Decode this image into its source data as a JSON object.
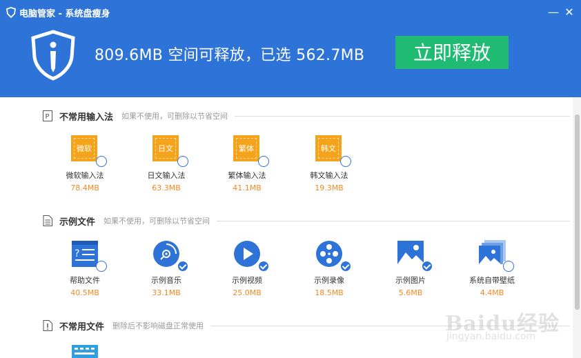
{
  "window": {
    "title": "电脑管家 - 系统盘瘦身",
    "minimize": "—",
    "close": "✕"
  },
  "header": {
    "headline": "809.6MB 空间可释放，已选 562.7MB",
    "release_button": "立即释放"
  },
  "sections": [
    {
      "title": "不常用输入法",
      "desc": "如果不使用，可删除以节省空间",
      "icon": "ime-p-icon",
      "items": [
        {
          "tile": "微软",
          "label": "微软输入法",
          "size": "78.4MB",
          "checked": false,
          "icon": "microsoft-ime-icon"
        },
        {
          "tile": "日文",
          "label": "日文输入法",
          "size": "63.3MB",
          "checked": false,
          "icon": "japanese-ime-icon"
        },
        {
          "tile": "繁体",
          "label": "繁体输入法",
          "size": "41.1MB",
          "checked": false,
          "icon": "traditional-chinese-ime-icon"
        },
        {
          "tile": "韩文",
          "label": "韩文输入法",
          "size": "19.3MB",
          "checked": false,
          "icon": "korean-ime-icon"
        }
      ]
    },
    {
      "title": "示例文件",
      "desc": "如果不使用，可删除以节省空间",
      "icon": "document-icon",
      "items": [
        {
          "label": "帮助文件",
          "size": "40.5MB",
          "checked": false,
          "icon": "help-file-icon"
        },
        {
          "label": "示例音乐",
          "size": "33.1MB",
          "checked": true,
          "icon": "music-disc-icon"
        },
        {
          "label": "示例视频",
          "size": "25.0MB",
          "checked": true,
          "icon": "video-play-icon"
        },
        {
          "label": "示例录像",
          "size": "18.5MB",
          "checked": true,
          "icon": "film-reel-icon"
        },
        {
          "label": "示例图片",
          "size": "5.6MB",
          "checked": true,
          "icon": "picture-icon"
        },
        {
          "label": "系统自带壁纸",
          "size": "4.4MB",
          "checked": false,
          "icon": "wallpaper-icon"
        }
      ]
    },
    {
      "title": "不常用文件",
      "desc": "删除后不影响磁盘正常使用",
      "icon": "file-alert-icon",
      "items": []
    }
  ],
  "watermark": {
    "brand": "Baidu经验",
    "url": "jingyan.baidu.com"
  },
  "colors": {
    "header_blue": "#2e73d8",
    "release_green": "#1fbb73",
    "size_orange": "#f08a24",
    "tile_orange": "#f5a31a"
  }
}
